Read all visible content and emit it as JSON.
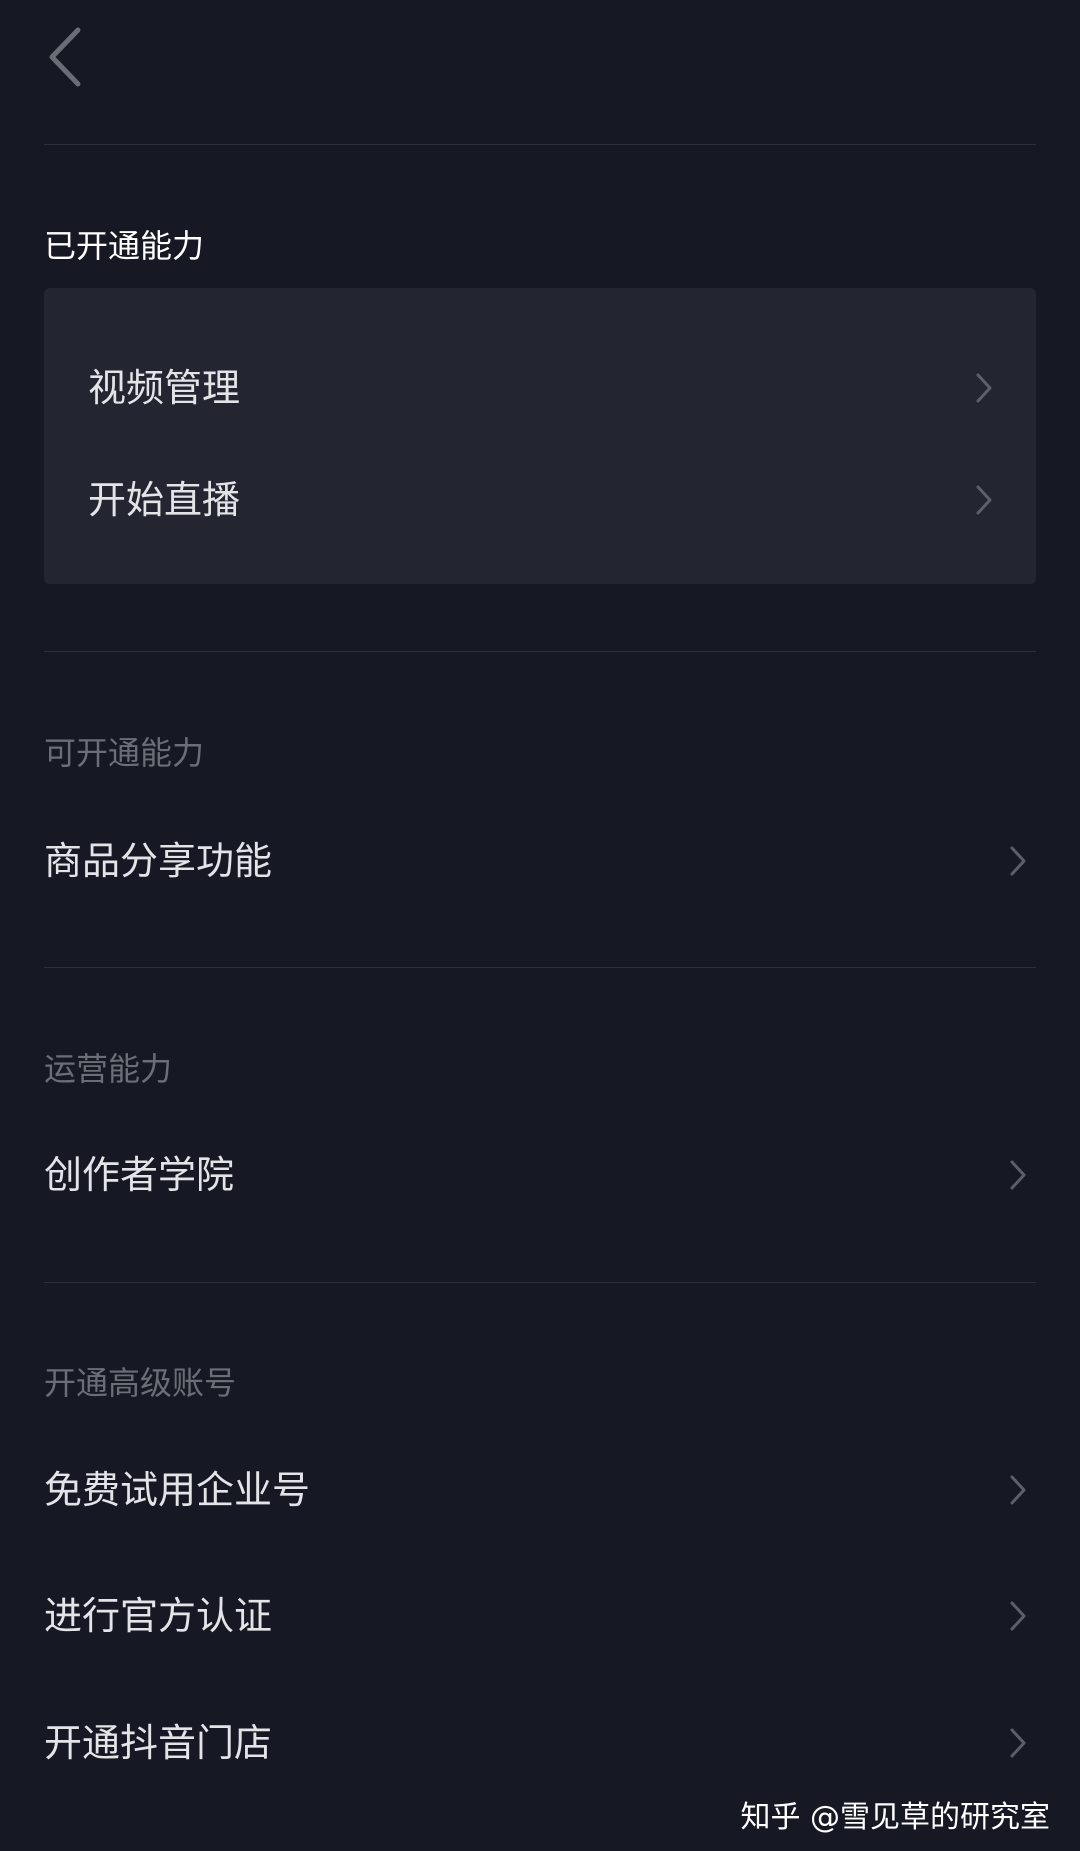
{
  "colors": {
    "background": "#161823",
    "card": "#232630",
    "divider": "#2c2e38",
    "text_primary": "#e3e4e8",
    "text_muted": "#6b6d77",
    "chevron": "#5c5f6a"
  },
  "header": {
    "back_icon": "chevron-left-icon"
  },
  "enabled": {
    "title": "已开通能力",
    "items": [
      {
        "label": "视频管理",
        "icon": "chevron-right-icon"
      },
      {
        "label": "开始直播",
        "icon": "chevron-right-icon"
      }
    ]
  },
  "available": {
    "title": "可开通能力",
    "items": [
      {
        "label": "商品分享功能",
        "icon": "chevron-right-icon"
      }
    ]
  },
  "operations": {
    "title": "运营能力",
    "items": [
      {
        "label": "创作者学院",
        "icon": "chevron-right-icon"
      }
    ]
  },
  "advanced": {
    "title": "开通高级账号",
    "items": [
      {
        "label": "免费试用企业号",
        "icon": "chevron-right-icon"
      },
      {
        "label": "进行官方认证",
        "icon": "chevron-right-icon"
      },
      {
        "label": "开通抖音门店",
        "icon": "chevron-right-icon"
      }
    ]
  },
  "watermark": "知乎 @雪见草的研究室"
}
